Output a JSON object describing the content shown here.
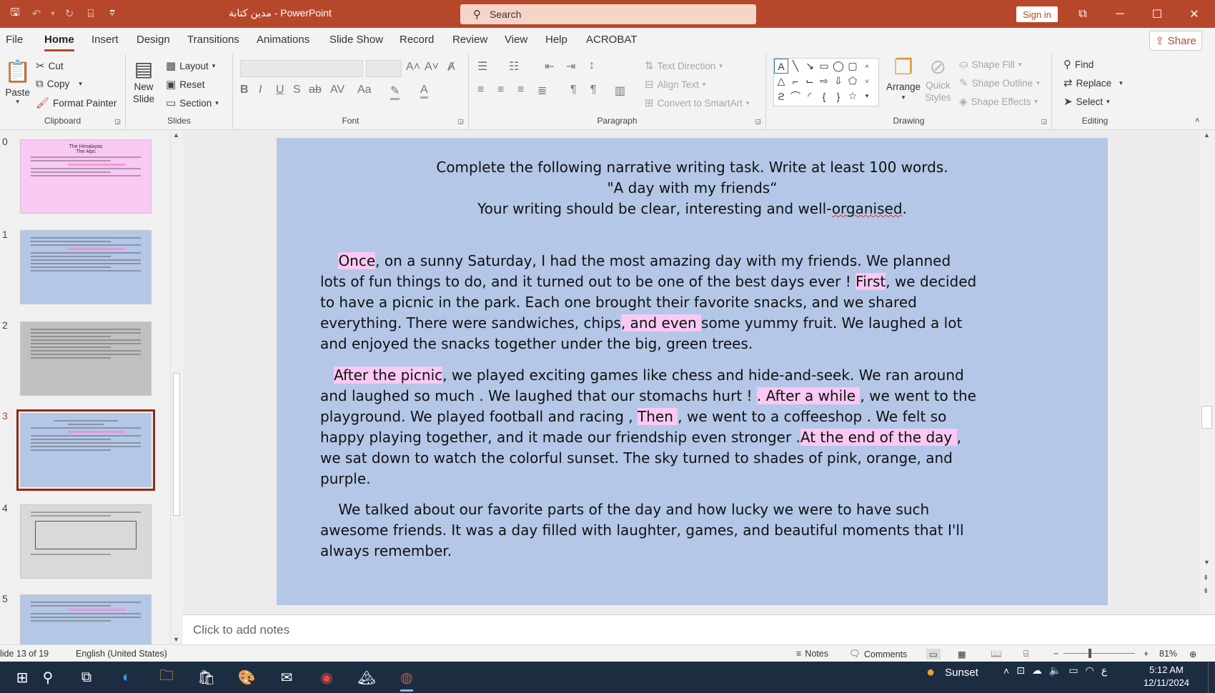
{
  "window": {
    "doc_title": "مدين كتابة  -  PowerPoint",
    "search_placeholder": "Search",
    "signin_label": "Sign in"
  },
  "menu": {
    "tabs": [
      "File",
      "Home",
      "Insert",
      "Design",
      "Transitions",
      "Animations",
      "Slide Show",
      "Record",
      "Review",
      "View",
      "Help",
      "ACROBAT"
    ],
    "share_label": "Share"
  },
  "ribbon": {
    "clipboard": {
      "paste": "Paste",
      "cut": "Cut",
      "copy": "Copy",
      "format_painter": "Format Painter",
      "label": "Clipboard"
    },
    "slides": {
      "new_slide_1": "New",
      "new_slide_2": "Slide",
      "layout": "Layout",
      "reset": "Reset",
      "section": "Section",
      "label": "Slides"
    },
    "font": {
      "label": "Font"
    },
    "paragraph": {
      "text_direction": "Text Direction",
      "align_text": "Align Text",
      "convert_smartart": "Convert to SmartArt",
      "label": "Paragraph"
    },
    "drawing": {
      "arrange": "Arrange",
      "quick_styles_1": "Quick",
      "quick_styles_2": "Styles",
      "shape_fill": "Shape Fill",
      "shape_outline": "Shape Outline",
      "shape_effects": "Shape Effects",
      "label": "Drawing"
    },
    "editing": {
      "find": "Find",
      "replace": "Replace",
      "select": "Select",
      "label": "Editing"
    }
  },
  "thumbnails": [
    {
      "num": "0",
      "bg": "#f9c8f3",
      "title": "The Himalayas",
      "sub": "The Alps"
    },
    {
      "num": "1",
      "bg": "#b4c7e7"
    },
    {
      "num": "2",
      "bg": "#c0c0c0"
    },
    {
      "num": "3",
      "bg": "#b4c7e7",
      "selected": true
    },
    {
      "num": "4",
      "bg": "#d9d9d9"
    },
    {
      "num": "5",
      "bg": "#b4c7e7"
    }
  ],
  "slide": {
    "heading_1": "Complete the following narrative writing task. Write at least 100 words.",
    "heading_2": "\"A day with my friends“",
    "heading_3a": "Your writing should be clear, interesting and well-",
    "heading_3b": "organised",
    "heading_3c": ".",
    "p1": [
      {
        "t": "    "
      },
      {
        "t": "Once",
        "h": true
      },
      {
        "t": ", on a sunny Saturday, I had the most amazing day with my friends. We planned"
      }
    ],
    "p1_l2": [
      {
        "t": "lots of fun things to do, and it turned out to be one of the best days ever ! "
      },
      {
        "t": "First",
        "h": true
      },
      {
        "t": ", we decided"
      }
    ],
    "p1_l3": [
      {
        "t": "to have a picnic in the park. Each one brought their favorite snacks, and we shared"
      }
    ],
    "p1_l4": [
      {
        "t": "everything. There were sandwiches, chips"
      },
      {
        "t": ", and even ",
        "h": true
      },
      {
        "t": "some yummy fruit. We laughed a lot"
      }
    ],
    "p1_l5": [
      {
        "t": "and enjoyed the snacks together under the big, green trees."
      }
    ],
    "p2_l1": [
      {
        "t": "   "
      },
      {
        "t": "After the picnic",
        "h": true
      },
      {
        "t": ", we played exciting games like chess and hide-and-seek. We ran around"
      }
    ],
    "p2_l2": [
      {
        "t": "and laughed so much . We laughed that our stomachs hurt ! "
      },
      {
        "t": ". After a while ",
        "h": true
      },
      {
        "t": ", we went to the"
      }
    ],
    "p2_l3": [
      {
        "t": "playground. We played football and racing , "
      },
      {
        "t": "Then ",
        "h": true
      },
      {
        "t": ", we went to a coffeeshop . We felt so"
      }
    ],
    "p2_l4": [
      {
        "t": "happy playing together, and it made our friendship even stronger ."
      },
      {
        "t": "At the end of the day ",
        "h": true
      },
      {
        "t": ","
      }
    ],
    "p2_l5": [
      {
        "t": "we sat down to watch the colorful sunset. The sky turned to shades of pink, orange, and"
      }
    ],
    "p2_l6": [
      {
        "t": "purple."
      }
    ],
    "p3_l1": [
      {
        "t": "    We talked about our favorite parts of the day and how lucky we were to have such"
      }
    ],
    "p3_l2": [
      {
        "t": "awesome friends. It was a day filled with laughter, games, and beautiful moments that I'll"
      }
    ],
    "p3_l3": [
      {
        "t": "always remember."
      }
    ]
  },
  "notes_placeholder": "Click to add notes",
  "status": {
    "slide_info": "lide 13 of 19",
    "language": "English (United States)",
    "notes": "Notes",
    "comments": "Comments",
    "zoom": "81%"
  },
  "taskbar": {
    "weather": "Sunset",
    "lang": "ع",
    "time": "5:12 AM",
    "date": "12/11/2024"
  }
}
